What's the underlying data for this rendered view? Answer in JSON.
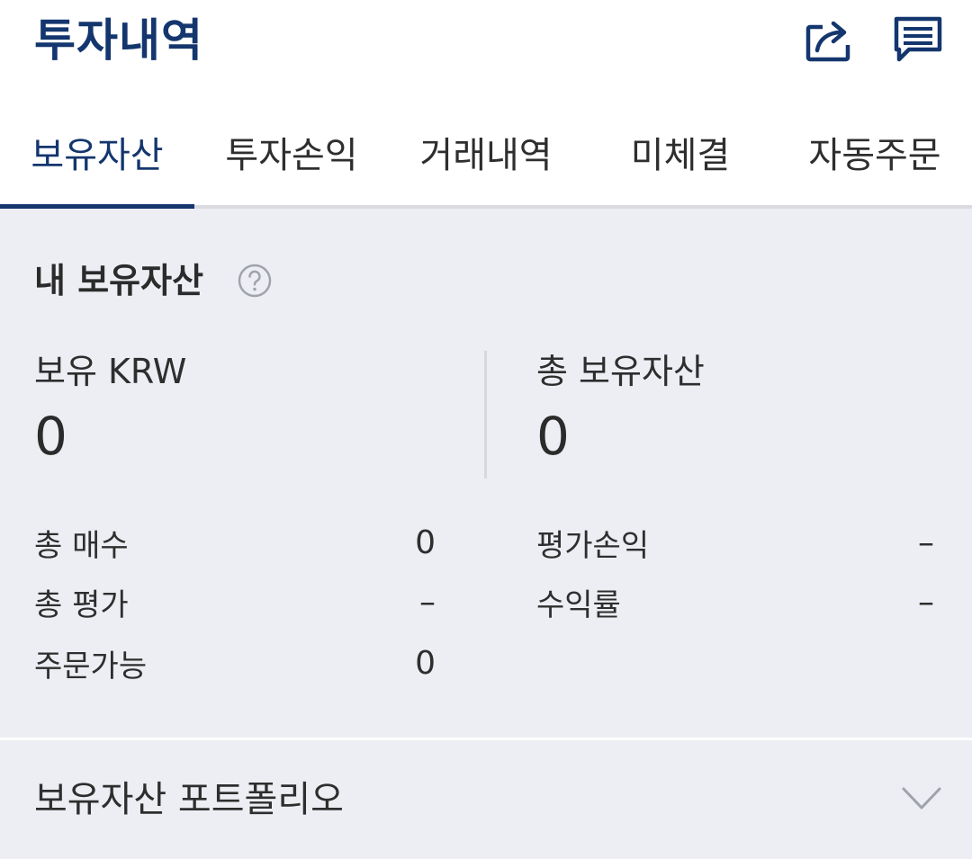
{
  "header": {
    "title": "투자내역",
    "icons": [
      "share-icon",
      "chat-icon"
    ]
  },
  "tabs": [
    {
      "label": "보유자산",
      "active": true
    },
    {
      "label": "투자손익",
      "active": false
    },
    {
      "label": "거래내역",
      "active": false
    },
    {
      "label": "미체결",
      "active": false
    },
    {
      "label": "자동주문",
      "active": false
    }
  ],
  "summary": {
    "title": "내 보유자산",
    "help_icon": "question-circle-icon",
    "krw_label": "보유 KRW",
    "krw_value": "0",
    "total_label": "총 보유자산",
    "total_value": "0",
    "left_rows": [
      {
        "label": "총 매수",
        "value": "0"
      },
      {
        "label": "총 평가",
        "value": "–"
      },
      {
        "label": "주문가능",
        "value": "0"
      }
    ],
    "right_rows": [
      {
        "label": "평가손익",
        "value": "–"
      },
      {
        "label": "수익률",
        "value": "–"
      }
    ]
  },
  "portfolio": {
    "title": "보유자산 포트폴리오",
    "expand_icon": "chevron-down-icon"
  },
  "colors": {
    "brand": "#14366e",
    "panel_bg": "#eceef3",
    "tab_border": "#dadbe0",
    "icon_gray": "#a0a3aa"
  }
}
